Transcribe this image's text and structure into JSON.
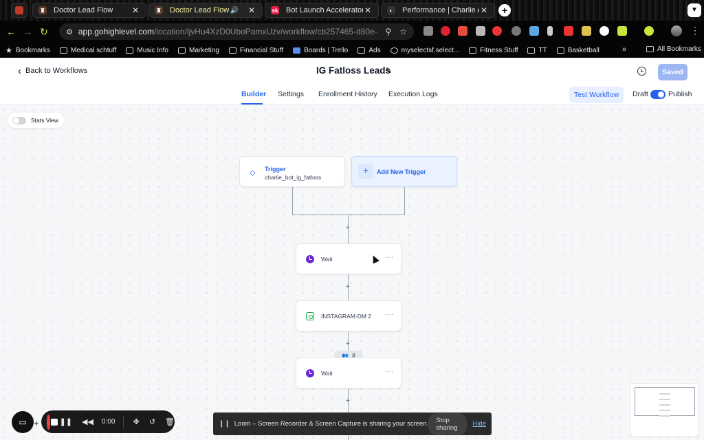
{
  "browser": {
    "tabs": [
      {
        "title": "Doctor Lead Flow",
        "active": false
      },
      {
        "title": "Doctor Lead Flow",
        "active": true
      },
      {
        "title": "Bot Launch Accelerator",
        "active": false,
        "favicon_text": "sk"
      },
      {
        "title": "Performance | Charlie AI",
        "active": false
      }
    ],
    "url_host": "app.gohighlevel.com",
    "url_path": "/location/ljvHu4XzD0UboPamxUzv/workflow/cb257465-d80e-47ed-9...",
    "bookmarks": [
      "Bookmarks",
      "Medical schtuff",
      "Music Info",
      "Marketing",
      "Financial Stuff",
      "Boards | Trello",
      "Ads",
      "myselectsf.select...",
      "Fitness Stuff",
      "TT",
      "Basketball"
    ],
    "all_bookmarks": "All Bookmarks",
    "more_bookmarks": "»"
  },
  "header": {
    "back_label": "Back to Workflows",
    "workflow_title": "IG Fatloss Leads",
    "saved_label": "Saved"
  },
  "subnav": {
    "tabs": [
      "Builder",
      "Settings",
      "Enrollment History",
      "Execution Logs"
    ],
    "active_tab": "Builder",
    "test_label": "Test Workflow",
    "draft_label": "Draft",
    "publish_label": "Publish",
    "published": true
  },
  "canvas": {
    "stats_view_label": "Stats View",
    "trigger": {
      "title": "Trigger",
      "subtitle": "charlie_bot_ig_fatloss"
    },
    "add_trigger_label": "Add New Trigger",
    "steps": [
      {
        "label": "Wait",
        "icon": "clock-icon"
      },
      {
        "label": "INSTAGRAM-DM 2",
        "icon": "instagram-icon"
      },
      {
        "label": "Wait",
        "icon": "clock-icon"
      }
    ],
    "contacts_count": "8",
    "more_glyph": "···",
    "plus_glyph": "+"
  },
  "loom": {
    "timer": "0:00",
    "share_message": "Loom – Screen Recorder & Screen Capture is sharing your screen.",
    "stop_label": "Stop sharing",
    "hide_label": "Hide"
  },
  "colors": {
    "accent": "#2563eb",
    "saved_button": "#9db7f2",
    "wait_icon": "#6d28d9",
    "instagram_icon": "#16a34a",
    "record": "#ef4444"
  }
}
